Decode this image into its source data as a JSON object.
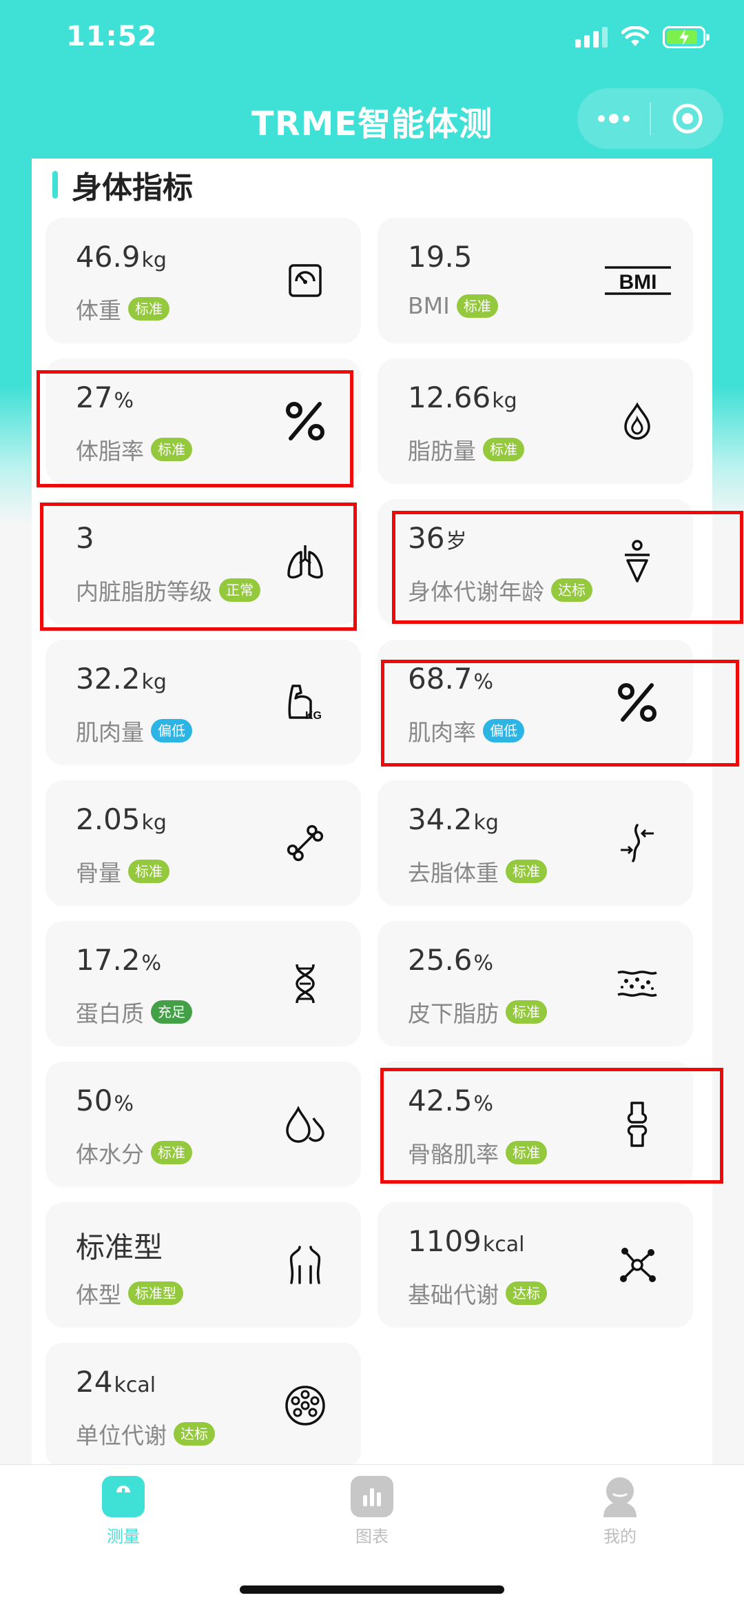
{
  "status_bar": {
    "time": "11:52"
  },
  "nav": {
    "title": "TRME智能体测"
  },
  "section": {
    "title": "身体指标"
  },
  "metrics": [
    {
      "value": "46.9",
      "unit": "kg",
      "label": "体重",
      "tag": "标准",
      "tag_color": "#94c83d",
      "icon": "scale-icon"
    },
    {
      "value": "19.5",
      "unit": "",
      "label": "BMI",
      "tag": "标准",
      "tag_color": "#94c83d",
      "icon": "bmi-icon"
    },
    {
      "value": "27",
      "unit": "%",
      "label": "体脂率",
      "tag": "标准",
      "tag_color": "#94c83d",
      "icon": "percent-icon"
    },
    {
      "value": "12.66",
      "unit": "kg",
      "label": "脂肪量",
      "tag": "标准",
      "tag_color": "#94c83d",
      "icon": "fat-drop-icon"
    },
    {
      "value": "3",
      "unit": "",
      "label": "内脏脂肪等级",
      "tag": "正常",
      "tag_color": "#94c83d",
      "icon": "lungs-icon"
    },
    {
      "value": "36",
      "unit": "岁",
      "label": "身体代谢年龄",
      "tag": "达标",
      "tag_color": "#94c83d",
      "icon": "body-figure-icon"
    },
    {
      "value": "32.2",
      "unit": "kg",
      "label": "肌肉量",
      "tag": "偏低",
      "tag_color": "#2cb4e4",
      "icon": "muscle-arm-icon"
    },
    {
      "value": "68.7",
      "unit": "%",
      "label": "肌肉率",
      "tag": "偏低",
      "tag_color": "#2cb4e4",
      "icon": "percent-icon"
    },
    {
      "value": "2.05",
      "unit": "kg",
      "label": "骨量",
      "tag": "标准",
      "tag_color": "#94c83d",
      "icon": "bone-icon"
    },
    {
      "value": "34.2",
      "unit": "kg",
      "label": "去脂体重",
      "tag": "标准",
      "tag_color": "#94c83d",
      "icon": "lean-mass-icon"
    },
    {
      "value": "17.2",
      "unit": "%",
      "label": "蛋白质",
      "tag": "充足",
      "tag_color": "#43a047",
      "icon": "dna-icon"
    },
    {
      "value": "25.6",
      "unit": "%",
      "label": "皮下脂肪",
      "tag": "标准",
      "tag_color": "#94c83d",
      "icon": "skin-fat-icon"
    },
    {
      "value": "50",
      "unit": "%",
      "label": "体水分",
      "tag": "标准",
      "tag_color": "#94c83d",
      "icon": "water-drops-icon"
    },
    {
      "value": "42.5",
      "unit": "%",
      "label": "骨骼肌率",
      "tag": "标准",
      "tag_color": "#94c83d",
      "icon": "joint-icon"
    },
    {
      "value": "标准型",
      "unit": "",
      "label": "体型",
      "tag": "标准型",
      "tag_color": "#94c83d",
      "icon": "body-shape-icon"
    },
    {
      "value": "1109",
      "unit": "kcal",
      "label": "基础代谢",
      "tag": "达标",
      "tag_color": "#94c83d",
      "icon": "molecule-icon"
    },
    {
      "value": "24",
      "unit": "kcal",
      "label": "单位代谢",
      "tag": "达标",
      "tag_color": "#94c83d",
      "icon": "cell-icon"
    }
  ],
  "tabbar": {
    "items": [
      {
        "label": "测量",
        "icon": "scale-icon",
        "active": true
      },
      {
        "label": "图表",
        "icon": "chart-icon",
        "active": false
      },
      {
        "label": "我的",
        "icon": "user-icon",
        "active": false
      }
    ]
  },
  "colors": {
    "accent": "#3fe0d6",
    "highlight_box": "#ef0a0a",
    "inactive_tab": "#c7c7c7"
  }
}
